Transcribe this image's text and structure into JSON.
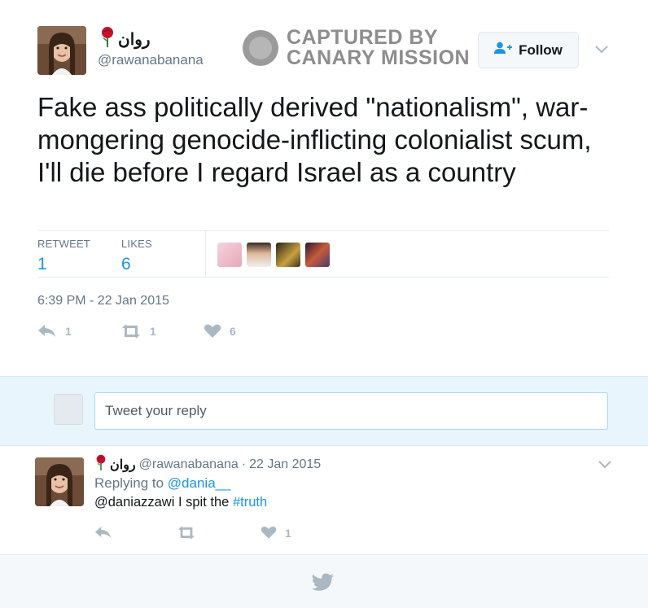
{
  "author": {
    "display_name": "روان",
    "handle": "@rawanabanana",
    "rose_icon": "rose-emoji"
  },
  "watermark": {
    "line1": "CAPTURED BY",
    "line2": "CANARY MISSION"
  },
  "follow_button": {
    "label": "Follow"
  },
  "tweet": {
    "text": "Fake ass politically derived \"nationalism\", war-mongering genocide-inflicting colonialist scum, I'll die before I regard Israel as a country",
    "timestamp": "6:39 PM - 22 Jan 2015"
  },
  "stats": {
    "retweet_label": "RETWEET",
    "retweet_count": "1",
    "likes_label": "LIKES",
    "likes_count": "6"
  },
  "actions": {
    "reply_count": "1",
    "retweet_count": "1",
    "like_count": "6"
  },
  "reply_box": {
    "placeholder": "Tweet your reply"
  },
  "reply_tweet": {
    "display_name": "روان",
    "handle": "@rawanabanana",
    "separator": "·",
    "date": "22 Jan 2015",
    "replying_prefix": "Replying to",
    "replying_to": "@dania__",
    "text_prefix": "@daniazzawi I spit the",
    "hashtag": "#truth",
    "like_count": "1"
  },
  "colors": {
    "accent": "#1b95e0",
    "muted": "#657786",
    "icon_gray": "#aab8c2",
    "reply_bg": "#e8f5fd",
    "footer_bg": "#f5f8fa"
  }
}
